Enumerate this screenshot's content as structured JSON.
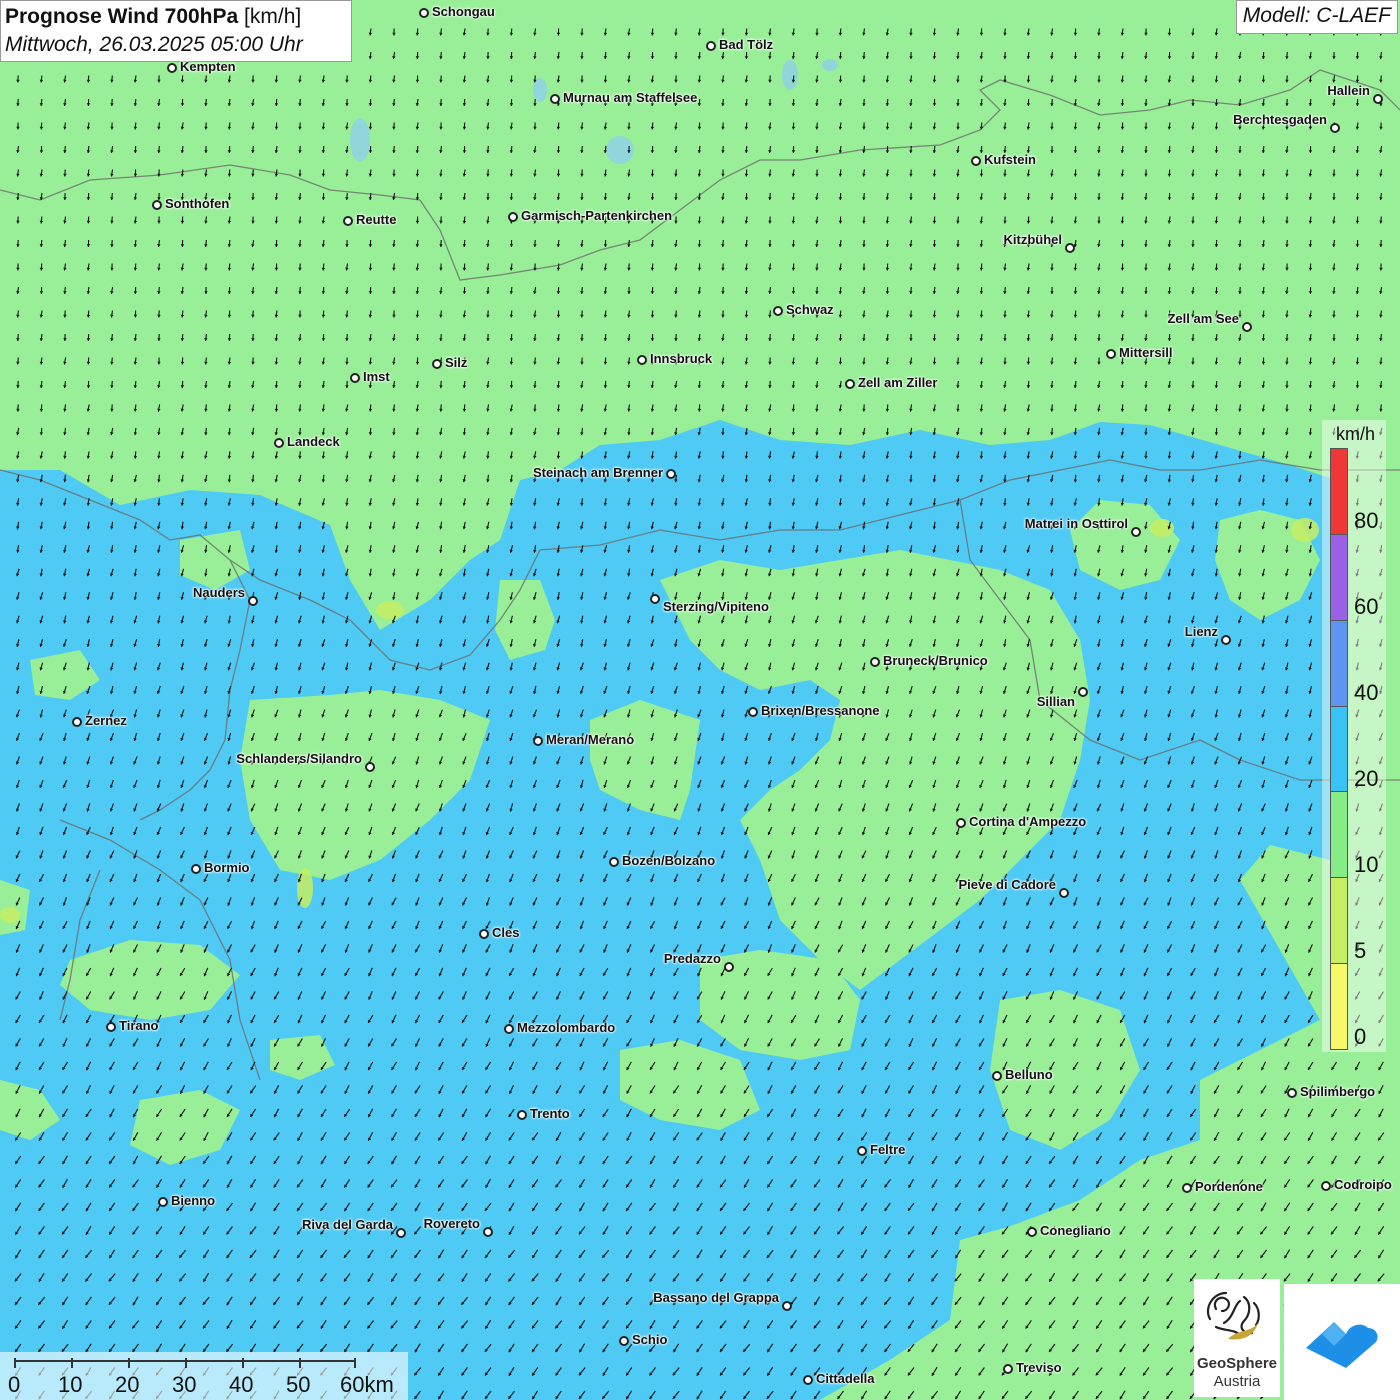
{
  "header": {
    "title": "Prognose Wind 700hPa",
    "unit": "[km/h]",
    "datetime": "Mittwoch, 26.03.2025 05:00 Uhr",
    "model": "Modell: C-LAEF"
  },
  "legend": {
    "unit": "km/h",
    "labels": [
      "80",
      "60",
      "40",
      "20",
      "10",
      "5",
      "0"
    ],
    "colors": [
      "#ee3838",
      "#9a62e6",
      "#5f95ef",
      "#39c2f4",
      "#86ec86",
      "#c6ee62",
      "#f7f76a"
    ]
  },
  "scalebar": {
    "labels": [
      "0",
      "10",
      "20",
      "30",
      "40",
      "50",
      "60km"
    ]
  },
  "logos": {
    "geosphere_line1": "GeoSphere",
    "geosphere_line2": "Austria"
  },
  "colors": {
    "wind_low": "#98ef98",
    "wind_mid": "#4fcaf4",
    "wind_arrows": "#111111"
  },
  "cities": [
    {
      "name": "Schongau",
      "side": "r"
    },
    {
      "name": "Bad Tölz",
      "side": "r"
    },
    {
      "name": "Kempten",
      "side": "r"
    },
    {
      "name": "Murnau am Staffelsee",
      "side": "r"
    },
    {
      "name": "Hallein",
      "side": "l"
    },
    {
      "name": "Berchtesgaden",
      "side": "l"
    },
    {
      "name": "Kufstein",
      "side": "r"
    },
    {
      "name": "Sonthofen",
      "side": "r"
    },
    {
      "name": "Reutte",
      "side": "r"
    },
    {
      "name": "Garmisch-Partenkirchen",
      "side": "r"
    },
    {
      "name": "Kitzbühel",
      "side": "l"
    },
    {
      "name": "Schwaz",
      "side": "r"
    },
    {
      "name": "Zell am See",
      "side": "l"
    },
    {
      "name": "Mittersill",
      "side": "r"
    },
    {
      "name": "Innsbruck",
      "side": "r"
    },
    {
      "name": "Silz",
      "side": "r"
    },
    {
      "name": "Imst",
      "side": "r"
    },
    {
      "name": "Zell am Ziller",
      "side": "r"
    },
    {
      "name": "Landeck",
      "side": "r"
    },
    {
      "name": "Steinach am Brenner",
      "side": "l"
    },
    {
      "name": "Matrei in Osttirol",
      "side": "l"
    },
    {
      "name": "Nauders",
      "side": "l"
    },
    {
      "name": "Sterzing/Vipiteno",
      "side": "r"
    },
    {
      "name": "Lienz",
      "side": "l"
    },
    {
      "name": "Bruneck/Brunico",
      "side": "r"
    },
    {
      "name": "Sillian",
      "side": "l"
    },
    {
      "name": "Brixen/Bressanone",
      "side": "r"
    },
    {
      "name": "Zernez",
      "side": "r"
    },
    {
      "name": "Meran/Merano",
      "side": "r"
    },
    {
      "name": "Schlanders/Silandro",
      "side": "l"
    },
    {
      "name": "Cortina d'Ampezzo",
      "side": "r"
    },
    {
      "name": "Bozen/Bolzano",
      "side": "r"
    },
    {
      "name": "Bormio",
      "side": "r"
    },
    {
      "name": "Pieve di Cadore",
      "side": "l"
    },
    {
      "name": "Cles",
      "side": "r"
    },
    {
      "name": "Predazzo",
      "side": "l"
    },
    {
      "name": "Tirano",
      "side": "r"
    },
    {
      "name": "Mezzolombardo",
      "side": "r"
    },
    {
      "name": "Belluno",
      "side": "r"
    },
    {
      "name": "Spilimbergo",
      "side": "r"
    },
    {
      "name": "Trento",
      "side": "r"
    },
    {
      "name": "Feltre",
      "side": "r"
    },
    {
      "name": "Pordenone",
      "side": "r"
    },
    {
      "name": "Codroipo",
      "side": "r"
    },
    {
      "name": "Bienno",
      "side": "r"
    },
    {
      "name": "Riva del Garda",
      "side": "l"
    },
    {
      "name": "Rovereto",
      "side": "l"
    },
    {
      "name": "Conegliano",
      "side": "r"
    },
    {
      "name": "Bassano del Grappa",
      "side": "l"
    },
    {
      "name": "Schio",
      "side": "r"
    },
    {
      "name": "Treviso",
      "side": "r"
    },
    {
      "name": "Cittadella",
      "side": "r"
    }
  ]
}
